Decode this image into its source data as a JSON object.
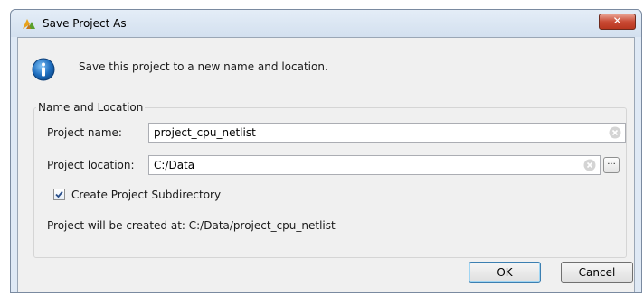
{
  "window": {
    "title": "Save Project As",
    "close_glyph": "✕"
  },
  "message": "Save this project to a new name and location.",
  "group": {
    "legend": "Name and Location",
    "project_name_label": "Project name:",
    "project_name_value": "project_cpu_netlist",
    "project_location_label": "Project location:",
    "project_location_value": "C:/Data",
    "browse_label": "...",
    "create_subdir_label": "Create Project Subdirectory",
    "create_subdir_checked": true,
    "result_text": "Project will be created at: C:/Data/project_cpu_netlist"
  },
  "buttons": {
    "ok": "OK",
    "cancel": "Cancel"
  },
  "icons": {
    "app": "vivado-logo-icon",
    "info": "info-icon",
    "clear": "clear-field-icon",
    "check": "check-icon"
  },
  "colors": {
    "close_button": "#c94a34",
    "info_icon": "#1f6fc0",
    "app_logo": "#e8a21a"
  }
}
